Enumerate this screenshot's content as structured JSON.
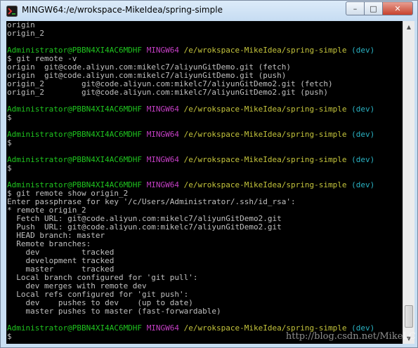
{
  "window": {
    "title": "MINGW64:/e/wrokspace-MikeIdea/spring-simple"
  },
  "colors": {
    "user": "#1fc51f",
    "host": "#c43fc4",
    "path": "#c4c43c",
    "branch": "#2ab3c4",
    "text": "#c0c0c0"
  },
  "icons": {
    "app": "mingw-terminal-icon",
    "minimize": "minimize-icon",
    "maximize": "maximize-icon",
    "close": "close-icon"
  },
  "terminal": {
    "lines": [
      {
        "kind": "text",
        "text": "origin"
      },
      {
        "kind": "text",
        "text": "origin_2"
      },
      {
        "kind": "blank"
      },
      {
        "kind": "prompt",
        "user": "Administrator@PBBN4XI4AC6MDHF",
        "host": "MINGW64",
        "path": "/e/wrokspace-MikeIdea/spring-simple",
        "branch": "(dev)"
      },
      {
        "kind": "text",
        "text": "$ git remote -v"
      },
      {
        "kind": "text",
        "text": "origin  git@code.aliyun.com:mikelc7/aliyunGitDemo.git (fetch)"
      },
      {
        "kind": "text",
        "text": "origin  git@code.aliyun.com:mikelc7/aliyunGitDemo.git (push)"
      },
      {
        "kind": "text",
        "text": "origin_2        git@code.aliyun.com:mikelc7/aliyunGitDemo2.git (fetch)"
      },
      {
        "kind": "text",
        "text": "origin_2        git@code.aliyun.com:mikelc7/aliyunGitDemo2.git (push)"
      },
      {
        "kind": "blank"
      },
      {
        "kind": "prompt",
        "user": "Administrator@PBBN4XI4AC6MDHF",
        "host": "MINGW64",
        "path": "/e/wrokspace-MikeIdea/spring-simple",
        "branch": "(dev)"
      },
      {
        "kind": "text",
        "text": "$"
      },
      {
        "kind": "blank"
      },
      {
        "kind": "prompt",
        "user": "Administrator@PBBN4XI4AC6MDHF",
        "host": "MINGW64",
        "path": "/e/wrokspace-MikeIdea/spring-simple",
        "branch": "(dev)"
      },
      {
        "kind": "text",
        "text": "$"
      },
      {
        "kind": "blank"
      },
      {
        "kind": "prompt",
        "user": "Administrator@PBBN4XI4AC6MDHF",
        "host": "MINGW64",
        "path": "/e/wrokspace-MikeIdea/spring-simple",
        "branch": "(dev)"
      },
      {
        "kind": "text",
        "text": "$"
      },
      {
        "kind": "blank"
      },
      {
        "kind": "prompt",
        "user": "Administrator@PBBN4XI4AC6MDHF",
        "host": "MINGW64",
        "path": "/e/wrokspace-MikeIdea/spring-simple",
        "branch": "(dev)"
      },
      {
        "kind": "text",
        "text": "$ git remote show origin_2"
      },
      {
        "kind": "text",
        "text": "Enter passphrase for key '/c/Users/Administrator/.ssh/id_rsa':"
      },
      {
        "kind": "text",
        "text": "* remote origin_2"
      },
      {
        "kind": "text",
        "text": "  Fetch URL: git@code.aliyun.com:mikelc7/aliyunGitDemo2.git"
      },
      {
        "kind": "text",
        "text": "  Push  URL: git@code.aliyun.com:mikelc7/aliyunGitDemo2.git"
      },
      {
        "kind": "text",
        "text": "  HEAD branch: master"
      },
      {
        "kind": "text",
        "text": "  Remote branches:"
      },
      {
        "kind": "text",
        "text": "    dev         tracked"
      },
      {
        "kind": "text",
        "text": "    development tracked"
      },
      {
        "kind": "text",
        "text": "    master      tracked"
      },
      {
        "kind": "text",
        "text": "  Local branch configured for 'git pull':"
      },
      {
        "kind": "text",
        "text": "    dev merges with remote dev"
      },
      {
        "kind": "text",
        "text": "  Local refs configured for 'git push':"
      },
      {
        "kind": "text",
        "text": "    dev    pushes to dev    (up to date)"
      },
      {
        "kind": "text",
        "text": "    master pushes to master (fast-forwardable)"
      },
      {
        "kind": "blank"
      },
      {
        "kind": "prompt",
        "user": "Administrator@PBBN4XI4AC6MDHF",
        "host": "MINGW64",
        "path": "/e/wrokspace-MikeIdea/spring-simple",
        "branch": "(dev)"
      },
      {
        "kind": "text",
        "text": "$"
      }
    ]
  },
  "watermark": "http://blog.csdn.net/MikeLC"
}
